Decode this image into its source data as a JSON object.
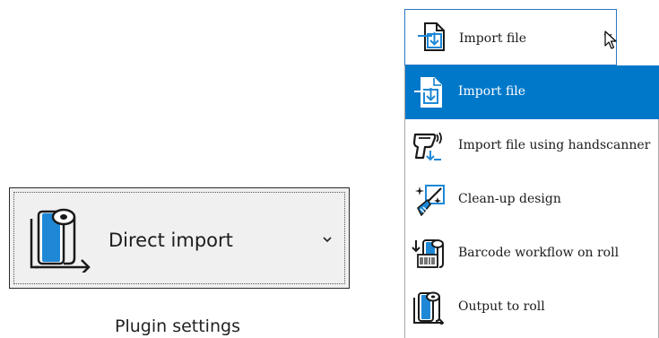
{
  "direct_import_button": {
    "label": "Direct import",
    "icon": "roll-output-icon"
  },
  "plugin_settings_caption": "Plugin settings",
  "import_dropdown": {
    "selected_label": "Import file",
    "icon": "import-file-icon",
    "items": [
      {
        "label": "Import file",
        "icon": "import-file-icon",
        "selected": true
      },
      {
        "label": "Import file using handscanner",
        "icon": "handscanner-icon",
        "selected": false
      },
      {
        "label": "Clean-up design",
        "icon": "clean-up-brush-icon",
        "selected": false
      },
      {
        "label": "Barcode workflow on roll",
        "icon": "barcode-roll-icon",
        "selected": false
      },
      {
        "label": "Output to roll",
        "icon": "roll-output-icon",
        "selected": false
      }
    ]
  },
  "colors": {
    "accent_blue": "#0078c9",
    "icon_blue": "#1e88d6",
    "combo_border": "#2b78c4"
  }
}
